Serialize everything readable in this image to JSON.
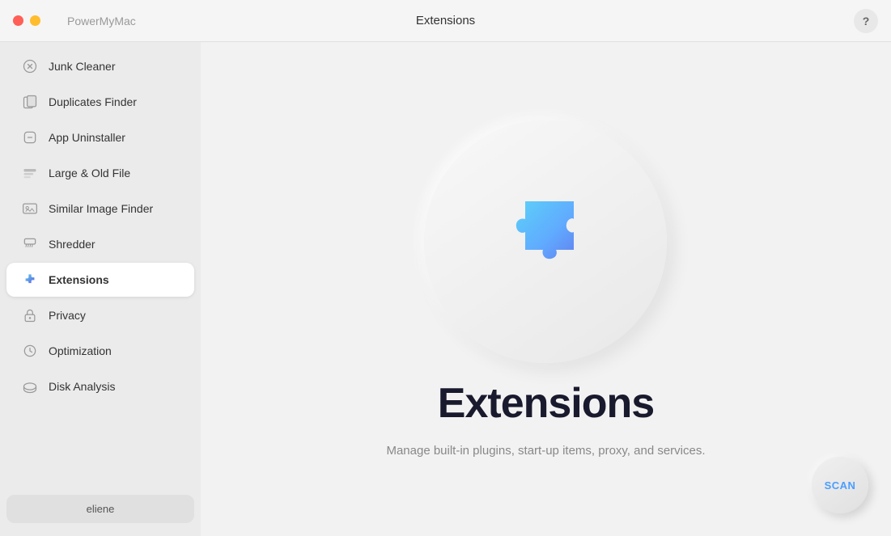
{
  "titlebar": {
    "app_name": "PowerMyMac",
    "center_title": "Extensions",
    "help_label": "?"
  },
  "sidebar": {
    "items": [
      {
        "id": "junk-cleaner",
        "label": "Junk Cleaner",
        "active": false
      },
      {
        "id": "duplicates-finder",
        "label": "Duplicates Finder",
        "active": false
      },
      {
        "id": "app-uninstaller",
        "label": "App Uninstaller",
        "active": false
      },
      {
        "id": "large-old-file",
        "label": "Large & Old File",
        "active": false
      },
      {
        "id": "similar-image-finder",
        "label": "Similar Image Finder",
        "active": false
      },
      {
        "id": "shredder",
        "label": "Shredder",
        "active": false
      },
      {
        "id": "extensions",
        "label": "Extensions",
        "active": true
      },
      {
        "id": "privacy",
        "label": "Privacy",
        "active": false
      },
      {
        "id": "optimization",
        "label": "Optimization",
        "active": false
      },
      {
        "id": "disk-analysis",
        "label": "Disk Analysis",
        "active": false
      }
    ],
    "user": "eliene"
  },
  "content": {
    "title": "Extensions",
    "subtitle": "Manage built-in plugins, start-up items, proxy, and services.",
    "scan_label": "SCAN"
  }
}
